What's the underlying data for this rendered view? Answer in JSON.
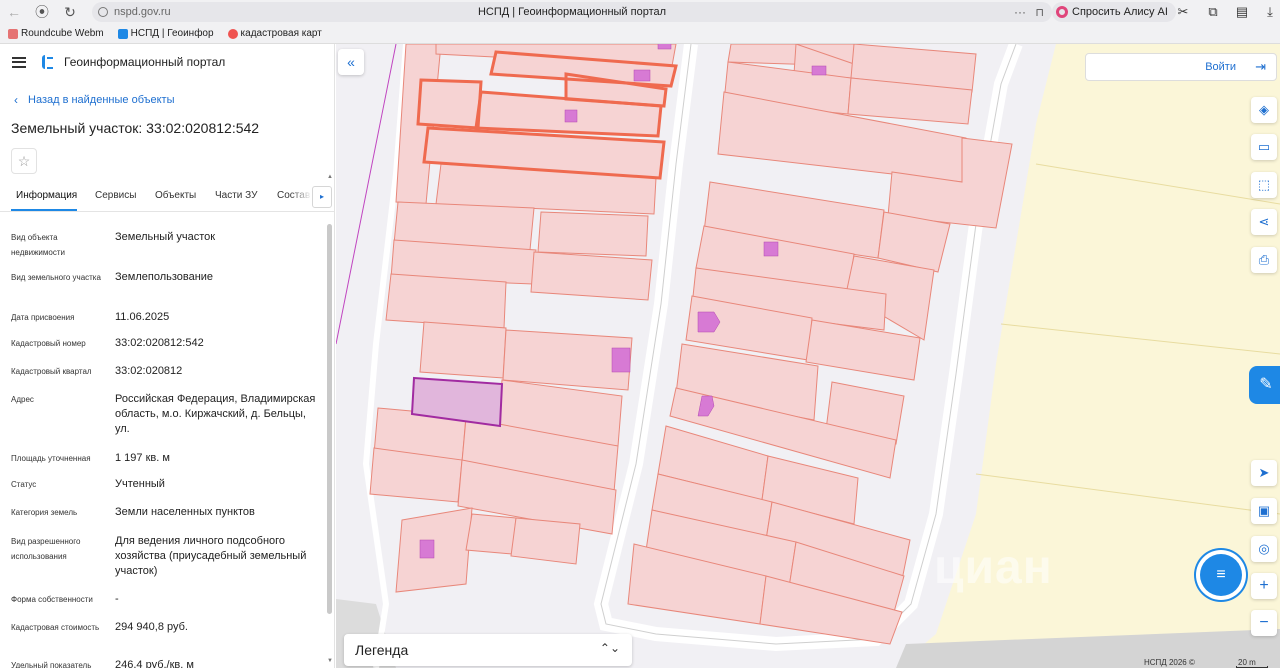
{
  "browser": {
    "url": "nspd.gov.ru",
    "tab_title": "НСПД | Геоинформационный портал",
    "more_label": "···",
    "alice_label": "Спросить Алису AI",
    "bookmarks": [
      {
        "label": "Roundcube Webm",
        "color": "#e57373"
      },
      {
        "label": "НСПД | Геоинфор",
        "color": "#1e88e5"
      },
      {
        "label": "кадастровая карт",
        "color": "#ef5350"
      }
    ]
  },
  "panel": {
    "portal_title": "Геоинформационный портал",
    "back_link": "Назад в найденные объекты",
    "title": "Земельный участок: 33:02:020812:542",
    "star_icon": "☆",
    "tabs": [
      "Информация",
      "Сервисы",
      "Объекты",
      "Части ЗУ",
      "Состав"
    ],
    "tab_more_icon": "▸",
    "properties": [
      {
        "label": "Вид объекта недвижимости",
        "value": "Земельный участок"
      },
      {
        "label": "Вид земельного участка",
        "value": "Землепользование"
      },
      {
        "label": "Дата присвоения",
        "value": "11.06.2025"
      },
      {
        "label": "Кадастровый номер",
        "value": "33:02:020812:542"
      },
      {
        "label": "Кадастровый квартал",
        "value": "33:02:020812"
      },
      {
        "label": "Адрес",
        "value": "Российская Федерация, Владимирская область, м.о. Киржачский, д. Бельцы, ул."
      },
      {
        "label": "Площадь уточненная",
        "value": "1 197 кв. м"
      },
      {
        "label": "Статус",
        "value": "Учтенный"
      },
      {
        "label": "Категория земель",
        "value": "Земли населенных пунктов"
      },
      {
        "label": "Вид разрешенного использования",
        "value": "Для ведения личного подсобного хозяйства (приусадебный земельный участок)"
      },
      {
        "label": "Форма собственности",
        "value": "-"
      },
      {
        "label": "Кадастровая стоимость",
        "value": "294 940,8 руб."
      },
      {
        "label": "Удельный показатель",
        "value": "246,4 руб./кв. м"
      }
    ]
  },
  "map": {
    "collapse_icon": "«",
    "login_label": "Войти",
    "login_icon": "⇥",
    "tools": [
      {
        "name": "layers-icon",
        "glyph": "◈"
      },
      {
        "name": "ruler-icon",
        "glyph": "▭"
      },
      {
        "name": "select-area-icon",
        "glyph": "⬚"
      },
      {
        "name": "share-icon",
        "glyph": "⋖"
      },
      {
        "name": "print-icon",
        "glyph": "⎙"
      }
    ],
    "lower_tools": [
      {
        "name": "navigate-icon",
        "glyph": "➤"
      },
      {
        "name": "minimap-icon",
        "glyph": "▣"
      },
      {
        "name": "locate-icon",
        "glyph": "◎"
      },
      {
        "name": "zoom-in-icon",
        "glyph": "+"
      },
      {
        "name": "zoom-out-icon",
        "glyph": "−"
      }
    ],
    "chat_icon": "✎",
    "chat_fab_icon": "≡",
    "legend_label": "Легенда",
    "legend_toggle": "⌃⌄",
    "copyright": "НСПД 2026 ©",
    "scale_label": "20 m",
    "watermark": "циан",
    "colors": {
      "accent": "#1e88e5",
      "parcel_fill": "#f6d3d3",
      "parcel_stroke": "#e8877a",
      "selected": "#a12ba1",
      "building": "#d77ad4",
      "field": "#fbf6d8"
    }
  }
}
